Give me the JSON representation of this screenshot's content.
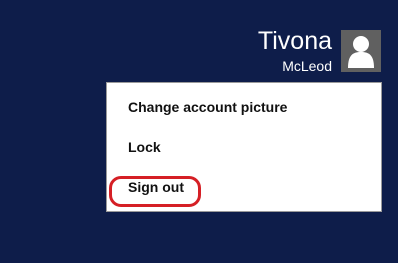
{
  "user": {
    "first_name": "Tivona",
    "last_name": "McLeod",
    "avatar_icon": "user-silhouette-icon"
  },
  "menu": {
    "items": [
      {
        "label": "Change account picture"
      },
      {
        "label": "Lock"
      },
      {
        "label": "Sign out"
      }
    ]
  },
  "colors": {
    "background": "#0e1d4a",
    "menu_background": "#ffffff",
    "highlight": "#d51f25"
  }
}
